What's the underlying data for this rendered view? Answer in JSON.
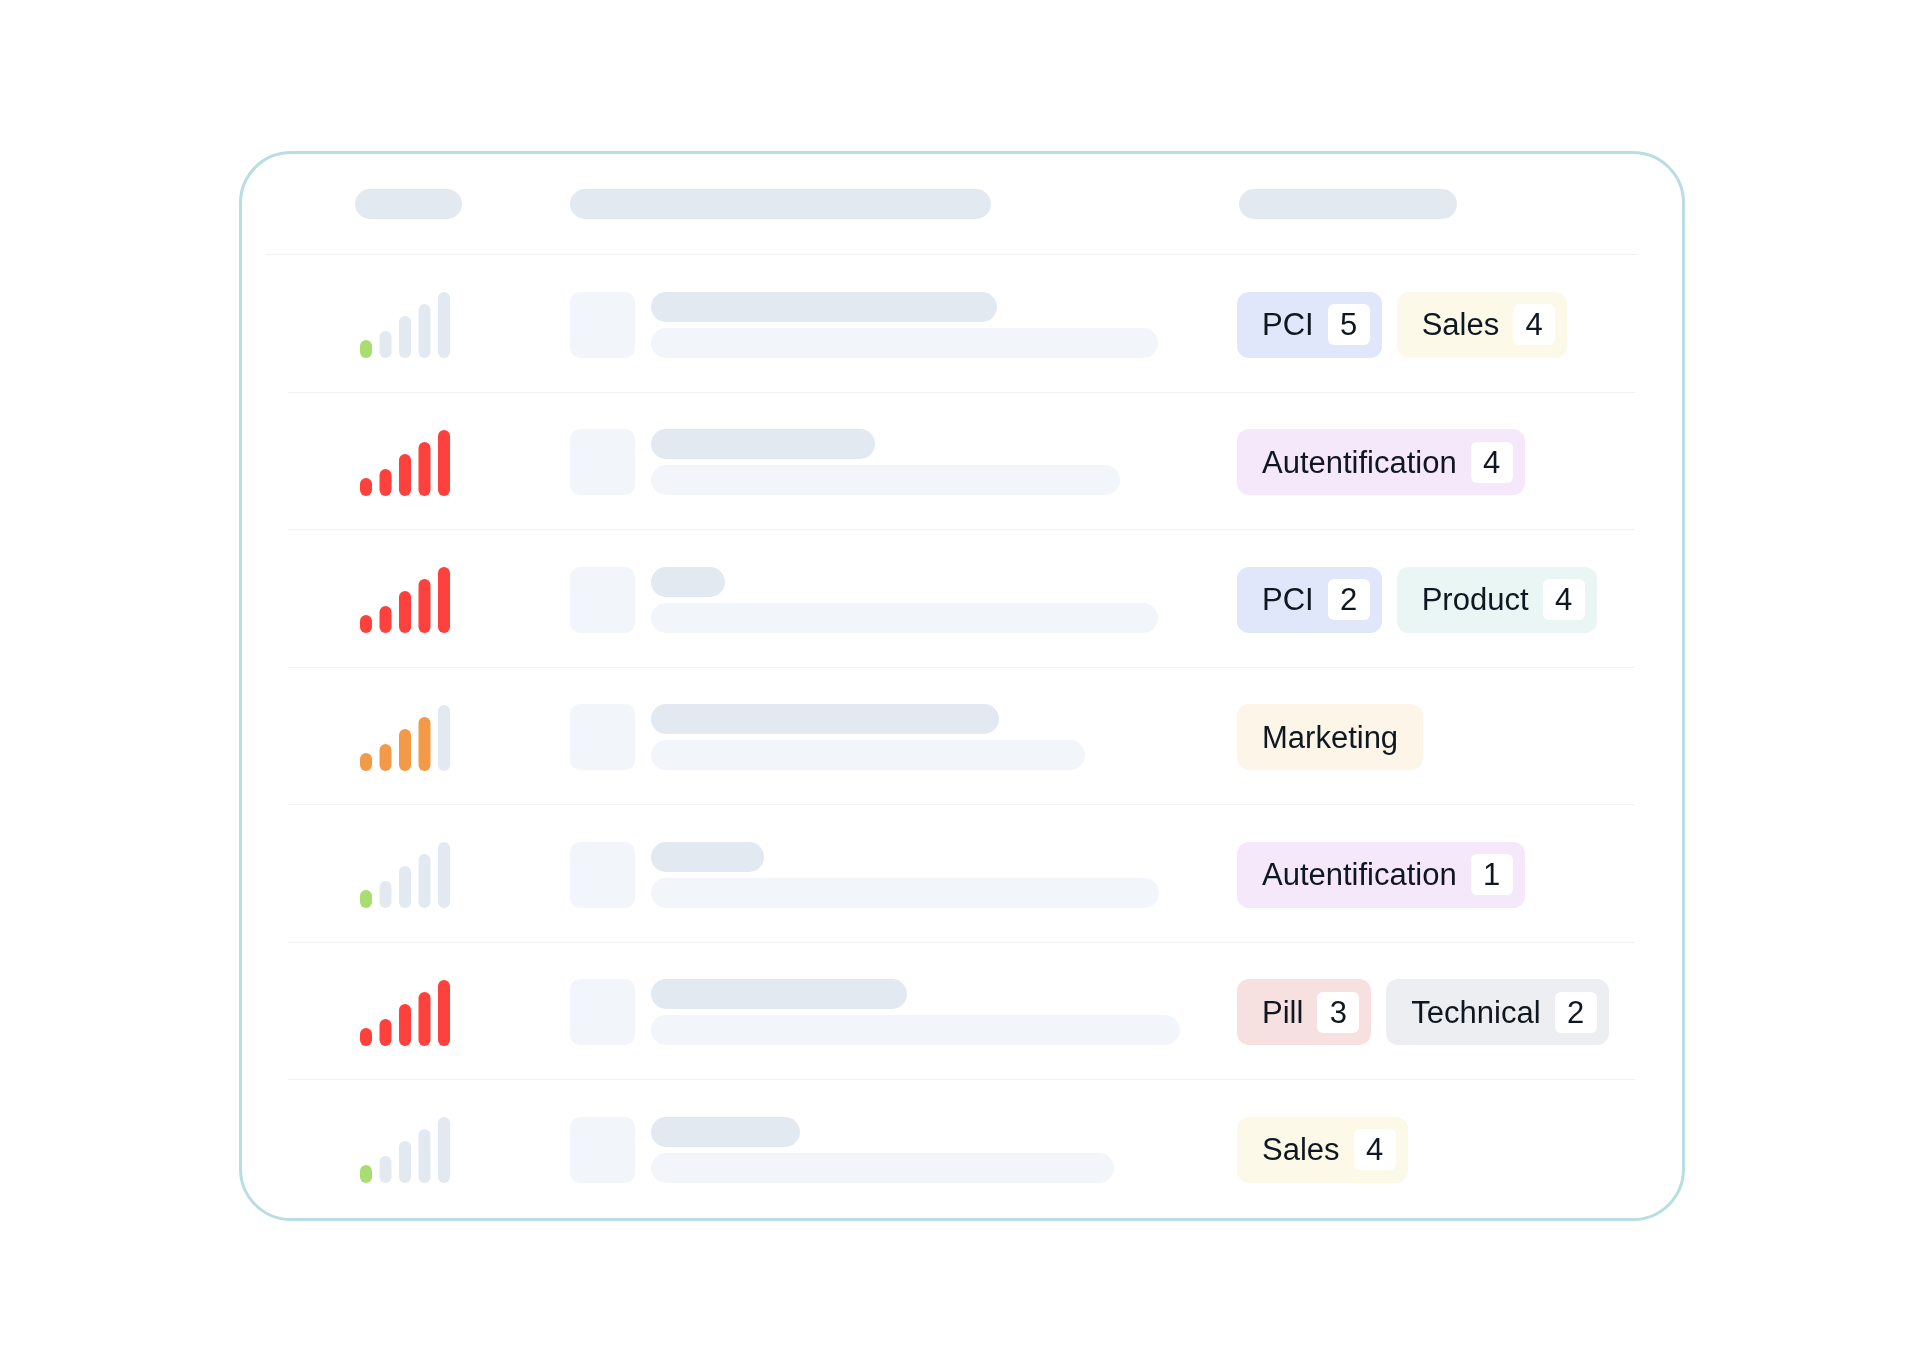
{
  "rows": [
    {
      "kind": "low",
      "tags": [
        {
          "label": "PCI",
          "count": "5",
          "color": "#e0e7fa"
        },
        {
          "label": "Sales",
          "count": "4",
          "color": "#fdf9e8"
        }
      ]
    },
    {
      "kind": "high",
      "tags": [
        {
          "label": "Autentification",
          "count": "4",
          "color": "#f5e8fb"
        }
      ]
    },
    {
      "kind": "high",
      "tags": [
        {
          "label": "PCI",
          "count": "2",
          "color": "#e0e7fa"
        },
        {
          "label": "Product",
          "count": "4",
          "color": "#e9f6f3"
        }
      ]
    },
    {
      "kind": "medium",
      "tags": [
        {
          "label": "Marketing",
          "color": "#fdf5e8"
        }
      ]
    },
    {
      "kind": "low",
      "tags": [
        {
          "label": "Autentification",
          "count": "1",
          "color": "#f5e8fb"
        }
      ]
    },
    {
      "kind": "high",
      "tags": [
        {
          "label": "Pill",
          "count": "3",
          "color": "#f6e0e0"
        },
        {
          "label": "Technical",
          "count": "2",
          "color": "#eceef2"
        }
      ]
    },
    {
      "kind": "low",
      "tags": [
        {
          "label": "Sales",
          "count": "4",
          "color": "#fdf9e8"
        }
      ]
    }
  ]
}
